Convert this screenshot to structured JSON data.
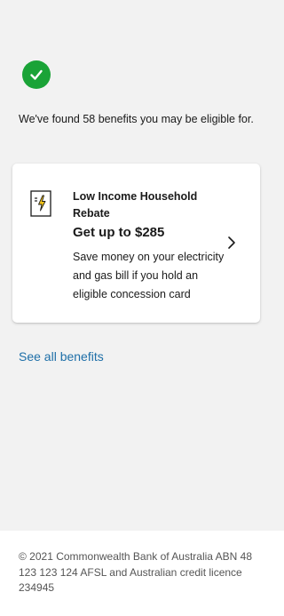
{
  "result": {
    "status_icon": "check-circle-icon",
    "status_color": "#1aa337",
    "found_text": "We've found 58 benefits you may be eligible for."
  },
  "benefit_card": {
    "icon": "electricity-bill-icon",
    "title": "Low Income Household Rebate",
    "amount": "Get up to $285",
    "description": "Save money on your electricity and gas bill if you hold an eligible concession card",
    "chevron_icon": "chevron-right-icon"
  },
  "links": {
    "see_all": "See all benefits",
    "link_color": "#1e6fa8"
  },
  "footer": {
    "legal": "© 2021 Commonwealth Bank of Australia ABN 48 123 123 124 AFSL and Australian credit licence 234945"
  }
}
